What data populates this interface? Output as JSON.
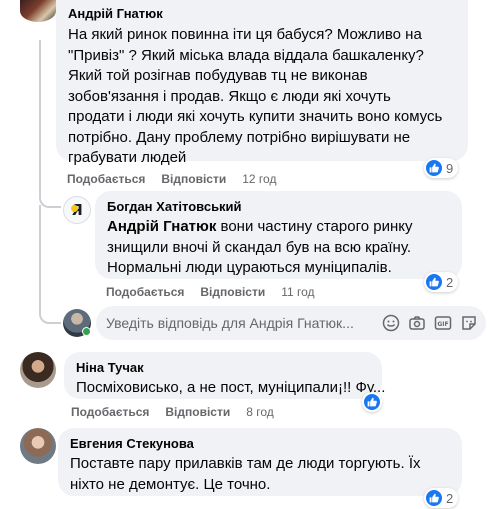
{
  "comments": [
    {
      "author": "Андрій Гнатюк",
      "lines": [
        "На який ринок повинна іти ця бабуся? Можливо на",
        "\"Привіз\" ? Який міська влада віддала башкаленку?",
        "Який той розігнав побудував тц не виконав",
        "зобов'язання і продав. Якщо є люди які хочуть",
        "продати і люди які хочуть купити значить воно комусь",
        "потрібно. Дану проблему потрібно вирішувати не",
        "грабувати людей"
      ],
      "like_label": "Подобається",
      "reply_label": "Відповісти",
      "time": "12 год",
      "reaction_count": "9"
    },
    {
      "author": "Богдан Хатітовський",
      "mention": "Андрій Гнатюк",
      "lines": [
        "вони частину старого ринку",
        "знищили вночі й скандал був на всю країну.",
        "Нормальні люди цураються муніципалів."
      ],
      "like_label": "Подобається",
      "reply_label": "Відповісти",
      "time": "11 год",
      "reaction_count": "2"
    },
    {
      "author": "Ніна Тучак",
      "lines": [
        "Посміховисько, а не пост, муніципали¡!! Фу..."
      ],
      "like_label": "Подобається",
      "reply_label": "Відповісти",
      "time": "8 год",
      "reaction_count": ""
    },
    {
      "author": "Евгения Стекунова",
      "lines": [
        "Поставте пару прилавків там де люди торгують. Їх",
        "ніхто не демонтує. Це точно."
      ],
      "reaction_count": "2"
    }
  ],
  "reply_box": {
    "placeholder": "Уведіть відповідь для Андрія Гнатюк..."
  },
  "colors": {
    "bubble": "#f0f2f5",
    "meta_text": "#65676b",
    "like_blue": "#1877f2",
    "online": "#31a24c"
  },
  "icons": [
    "emoji-icon",
    "camera-icon",
    "gif-icon",
    "sticker-icon",
    "like-reaction-icon"
  ]
}
